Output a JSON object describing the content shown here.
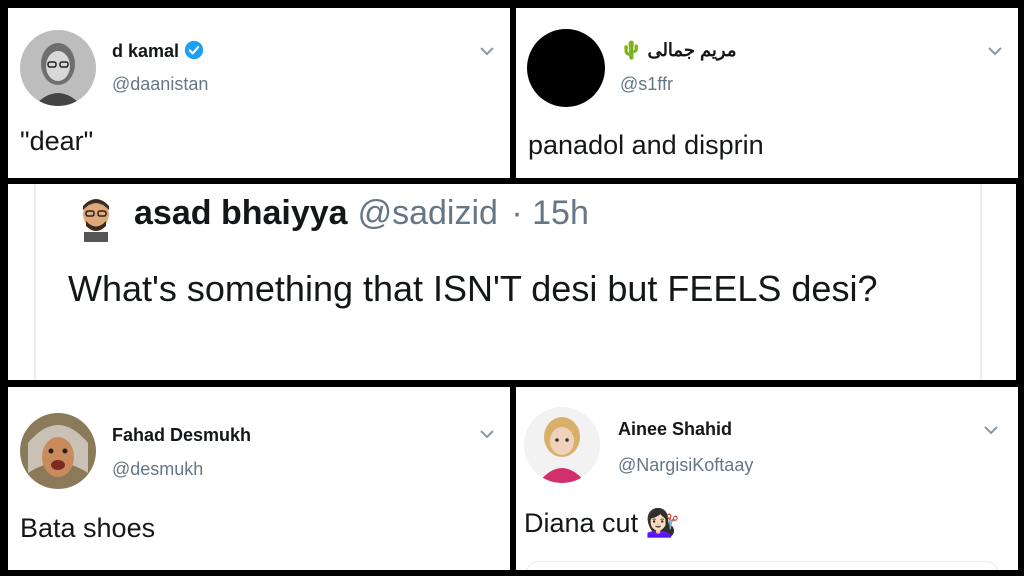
{
  "tweets": [
    {
      "name": "d kamal",
      "handle": "@daanistan",
      "text": "\"dear\"",
      "verified": true
    },
    {
      "name": "مریم جمالی",
      "name_emoji": "🌵",
      "handle": "@s1ffr",
      "text": "panadol and disprin"
    },
    {
      "name": "Fahad Desmukh",
      "handle": "@desmukh",
      "text": "Bata shoes"
    },
    {
      "name": "Ainee Shahid",
      "handle": "@NargisiKoftaay",
      "text": "Diana cut",
      "text_emoji": "💇🏻‍♀️"
    }
  ],
  "quoted": {
    "name": "asad bhaiyya",
    "handle": "@sadizid",
    "time": "· 15h",
    "text": "What's something that ISN'T desi but FEELS desi?"
  },
  "icons": {
    "verified": "verified-badge-icon",
    "chevron": "chevron-down-icon"
  },
  "colors": {
    "verified_blue": "#1da1f2",
    "handle_gray": "#657786",
    "text_dark": "#14171a"
  }
}
